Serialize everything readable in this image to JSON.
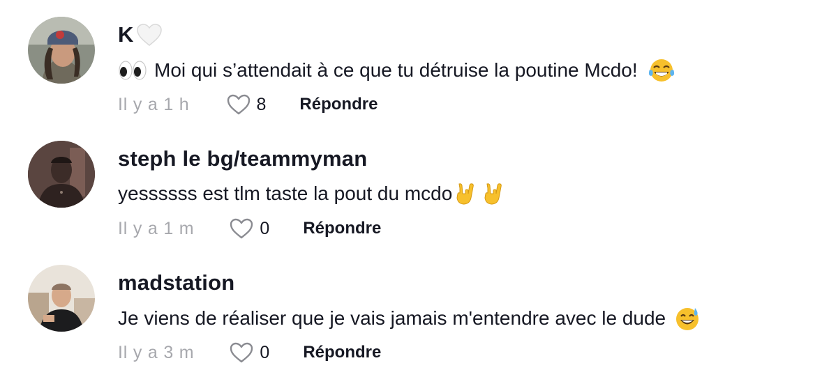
{
  "comments": [
    {
      "username": "K",
      "username_emoji": "white-heart-icon",
      "text_before": "Moi qui s’attendait à ce que tu détruise la poutine Mcdo!",
      "leading_emoji": "eyes-icon",
      "trailing_emoji": "tears-of-joy-icon",
      "time": "Il y a 1 h",
      "likes": "8",
      "reply_label": "Répondre"
    },
    {
      "username": "steph le bg/teammyman",
      "text_before": "yessssss est tlm taste la pout du mcdo",
      "trailing_emoji": "rock-on-hand-icon",
      "time": "Il y a 1 m",
      "likes": "0",
      "reply_label": "Répondre"
    },
    {
      "username": "madstation",
      "text_before": "Je viens de réaliser que je vais jamais m'entendre avec le dude",
      "trailing_emoji": "grinning-sweat-icon",
      "time": "Il y a 3 m",
      "likes": "0",
      "reply_label": "Répondre"
    }
  ],
  "colors": {
    "text": "#161823",
    "muted": "#a7a8ad",
    "emoji_yellow": "#f7c02c"
  }
}
